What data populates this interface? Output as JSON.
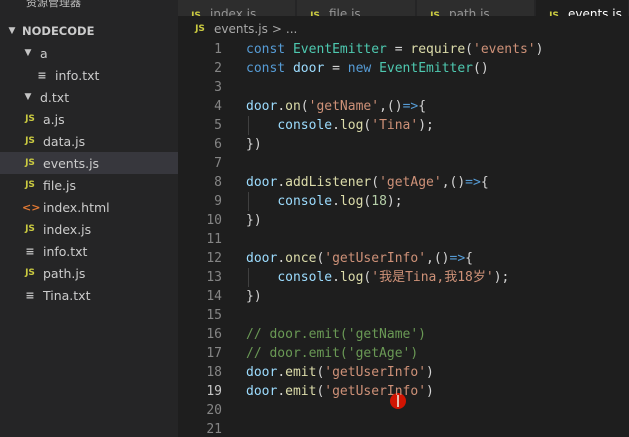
{
  "explorer": {
    "title": "资源管理器",
    "more_icon": "ellipsis-icon",
    "root_label": "NODECODE",
    "tree": [
      {
        "label": "a",
        "kind": "folder",
        "indent": 1,
        "expanded": true
      },
      {
        "label": "info.txt",
        "kind": "txt",
        "indent": 2
      },
      {
        "label": "d.txt",
        "kind": "folder",
        "indent": 1,
        "expanded": true
      },
      {
        "label": "a.js",
        "kind": "js",
        "indent": 1
      },
      {
        "label": "data.js",
        "kind": "js",
        "indent": 1
      },
      {
        "label": "events.js",
        "kind": "js",
        "indent": 1,
        "selected": true
      },
      {
        "label": "file.js",
        "kind": "js",
        "indent": 1
      },
      {
        "label": "index.html",
        "kind": "html",
        "indent": 1
      },
      {
        "label": "index.js",
        "kind": "js",
        "indent": 1
      },
      {
        "label": "info.txt",
        "kind": "txt",
        "indent": 1
      },
      {
        "label": "path.js",
        "kind": "js",
        "indent": 1
      },
      {
        "label": "Tina.txt",
        "kind": "txt",
        "indent": 1
      }
    ]
  },
  "tabs": [
    {
      "label": "index.js",
      "icon": "JS",
      "active": false
    },
    {
      "label": "file.js",
      "icon": "JS",
      "active": false
    },
    {
      "label": "path.js",
      "icon": "JS",
      "active": false
    },
    {
      "label": "events.js",
      "icon": "JS",
      "active": true
    }
  ],
  "breadcrumb": {
    "icon": "JS",
    "file": "events.js",
    "sep": ">",
    "rest": "..."
  },
  "code": [
    [
      [
        "t-kw",
        "const "
      ],
      [
        "t-cls",
        "EventEmitter"
      ],
      [
        "t-op",
        " = "
      ],
      [
        "t-fn",
        "require"
      ],
      [
        "t-pun",
        "("
      ],
      [
        "t-str",
        "'events'"
      ],
      [
        "t-pun",
        ")"
      ]
    ],
    [
      [
        "t-kw",
        "const "
      ],
      [
        "t-var",
        "door"
      ],
      [
        "t-op",
        " = "
      ],
      [
        "t-kw",
        "new "
      ],
      [
        "t-cls",
        "EventEmitter"
      ],
      [
        "t-pun",
        "()"
      ]
    ],
    [],
    [
      [
        "t-var",
        "door"
      ],
      [
        "t-pun",
        "."
      ],
      [
        "t-fn",
        "on"
      ],
      [
        "t-pun",
        "("
      ],
      [
        "t-str",
        "'getName'"
      ],
      [
        "t-pun",
        ",()"
      ],
      [
        "t-kw",
        "=>"
      ],
      [
        "t-pun",
        "{"
      ]
    ],
    [
      [
        "t-pun",
        "    "
      ],
      [
        "t-var",
        "console"
      ],
      [
        "t-pun",
        "."
      ],
      [
        "t-fn",
        "log"
      ],
      [
        "t-pun",
        "("
      ],
      [
        "t-str",
        "'Tina'"
      ],
      [
        "t-pun",
        ");"
      ]
    ],
    [
      [
        "t-pun",
        "})"
      ]
    ],
    [],
    [
      [
        "t-var",
        "door"
      ],
      [
        "t-pun",
        "."
      ],
      [
        "t-fn",
        "addListener"
      ],
      [
        "t-pun",
        "("
      ],
      [
        "t-str",
        "'getAge'"
      ],
      [
        "t-pun",
        ",()"
      ],
      [
        "t-kw",
        "=>"
      ],
      [
        "t-pun",
        "{"
      ]
    ],
    [
      [
        "t-pun",
        "    "
      ],
      [
        "t-var",
        "console"
      ],
      [
        "t-pun",
        "."
      ],
      [
        "t-fn",
        "log"
      ],
      [
        "t-pun",
        "("
      ],
      [
        "t-num",
        "18"
      ],
      [
        "t-pun",
        ");"
      ]
    ],
    [
      [
        "t-pun",
        "})"
      ]
    ],
    [],
    [
      [
        "t-var",
        "door"
      ],
      [
        "t-pun",
        "."
      ],
      [
        "t-fn",
        "once"
      ],
      [
        "t-pun",
        "("
      ],
      [
        "t-str",
        "'getUserInfo'"
      ],
      [
        "t-pun",
        ",()"
      ],
      [
        "t-kw",
        "=>"
      ],
      [
        "t-pun",
        "{"
      ]
    ],
    [
      [
        "t-pun",
        "    "
      ],
      [
        "t-var",
        "console"
      ],
      [
        "t-pun",
        "."
      ],
      [
        "t-fn",
        "log"
      ],
      [
        "t-pun",
        "("
      ],
      [
        "t-str",
        "'我是Tina,我18岁'"
      ],
      [
        "t-pun",
        ");"
      ]
    ],
    [
      [
        "t-pun",
        "})"
      ]
    ],
    [],
    [
      [
        "t-cmt",
        "// door.emit('getName')"
      ]
    ],
    [
      [
        "t-cmt",
        "// door.emit('getAge')"
      ]
    ],
    [
      [
        "t-var",
        "door"
      ],
      [
        "t-pun",
        "."
      ],
      [
        "t-fn",
        "emit"
      ],
      [
        "t-pun",
        "("
      ],
      [
        "t-str",
        "'getUserInfo'"
      ],
      [
        "t-pun",
        ")"
      ]
    ],
    [
      [
        "t-var",
        "door"
      ],
      [
        "t-pun",
        "."
      ],
      [
        "t-fn",
        "emit"
      ],
      [
        "t-pun",
        "("
      ],
      [
        "t-str",
        "'getUserInfo'"
      ],
      [
        "t-pun",
        ")"
      ]
    ],
    [],
    []
  ],
  "line_numbers": [
    "1",
    "2",
    "3",
    "4",
    "5",
    "6",
    "7",
    "8",
    "9",
    "10",
    "11",
    "12",
    "13",
    "14",
    "15",
    "16",
    "17",
    "18",
    "19",
    "20",
    "21"
  ],
  "active_line": 19,
  "colors": {
    "editor_bg": "#1e1e1e",
    "sidebar_bg": "#252526",
    "selection": "#37373d",
    "keyword": "#569cd6",
    "string": "#ce9178",
    "function": "#dcdcaa",
    "comment": "#6a9955",
    "cursor_marker": "#e51400"
  }
}
